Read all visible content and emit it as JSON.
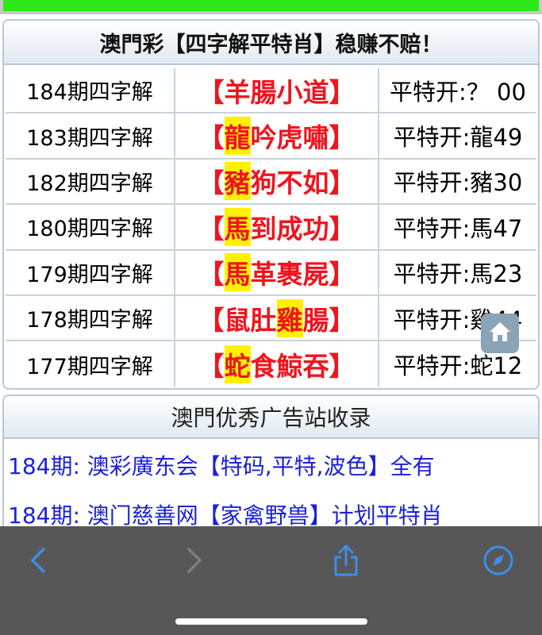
{
  "page": {
    "title": "澳門彩【四字解平特肖】稳赚不赔！",
    "rows": [
      {
        "period": "184期四字解",
        "pre": "【",
        "hl": "",
        "phrase": "羊腸小道",
        "post": "】",
        "result": "平特开:？ 00"
      },
      {
        "period": "183期四字解",
        "pre": "【",
        "hl": "龍",
        "phrase": "吟虎嘯",
        "post": "】",
        "result": "平特开:龍49"
      },
      {
        "period": "182期四字解",
        "pre": "【",
        "hl": "豬",
        "phrase": "狗不如",
        "post": "】",
        "result": "平特开:豬30"
      },
      {
        "period": "180期四字解",
        "pre": "【",
        "hl": "馬",
        "phrase": "到成功",
        "post": "】",
        "result": "平特开:馬47"
      },
      {
        "period": "179期四字解",
        "pre": "【",
        "hl": "馬",
        "phrase": "革裹屍",
        "post": "】",
        "result": "平特开:馬23"
      },
      {
        "period": "178期四字解",
        "pre": "【鼠肚",
        "hl": "雞",
        "phrase": "腸",
        "post": "】",
        "result": "平特开:雞44"
      },
      {
        "period": "177期四字解",
        "pre": "【",
        "hl": "蛇",
        "phrase": "食鯨吞",
        "post": "】",
        "result": "平特开:蛇12"
      }
    ]
  },
  "section2": {
    "title": "澳門优秀广告站收录",
    "links": [
      "184期: 澳彩廣东会【特码,平特,波色】全有",
      "184期: 澳门慈善网【家禽野兽】计划平特肖"
    ]
  },
  "colors": {
    "accent_red": "#f0141e",
    "highlight": "#fff100",
    "link_blue": "#1a22d8",
    "top_green": "#2ee81c"
  },
  "icons": [
    "home-icon",
    "back-icon",
    "forward-icon",
    "share-icon",
    "compass-icon"
  ]
}
